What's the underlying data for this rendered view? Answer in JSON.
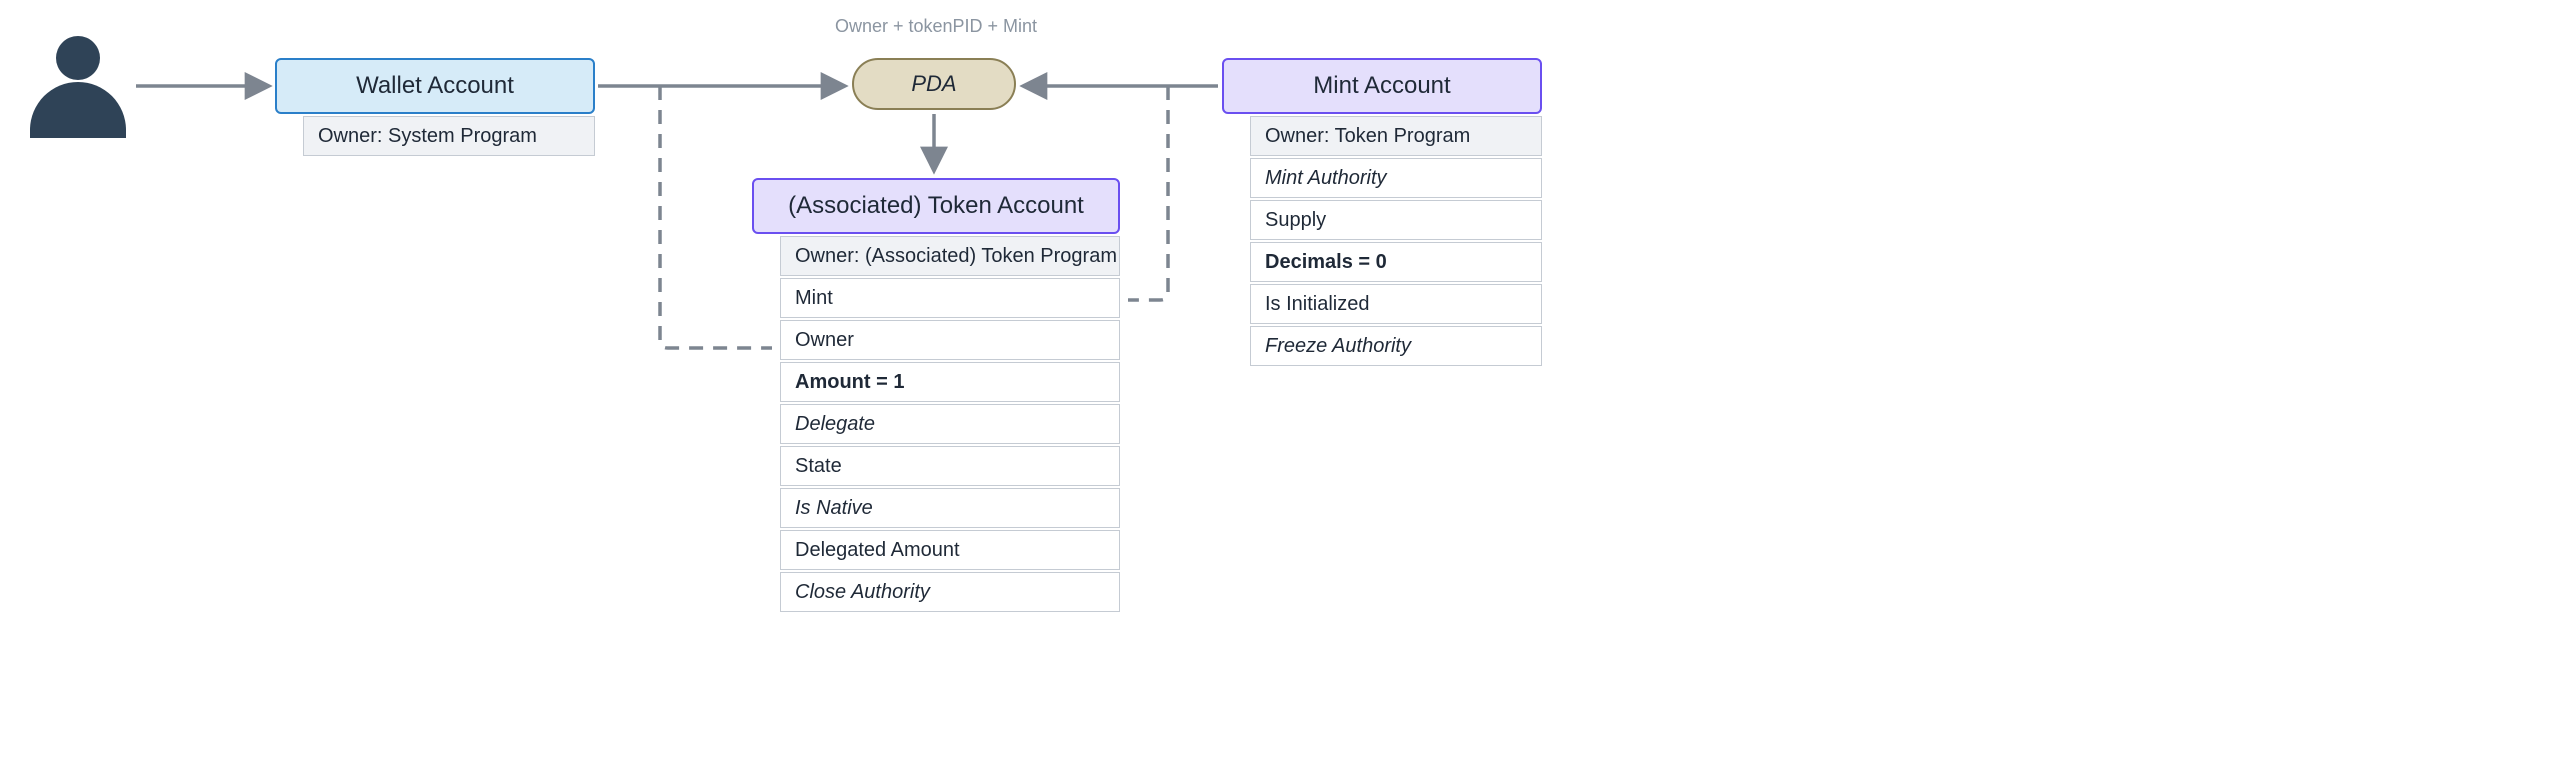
{
  "pda": {
    "annotation": "Owner + tokenPID + Mint",
    "label": "PDA"
  },
  "wallet": {
    "title": "Wallet Account",
    "owner": "Owner: System Program"
  },
  "token": {
    "title": "(Associated) Token Account",
    "owner": "Owner: (Associated) Token Program",
    "fields": {
      "mint": "Mint",
      "owner": "Owner",
      "amount": "Amount = 1",
      "delegate": "Delegate",
      "state": "State",
      "is_native": "Is Native",
      "delegated_amount": "Delegated Amount",
      "close_authority": "Close Authority"
    }
  },
  "mint": {
    "title": "Mint Account",
    "owner": "Owner: Token Program",
    "fields": {
      "mint_authority": "Mint Authority",
      "supply": "Supply",
      "decimals": "Decimals = 0",
      "is_initialized": "Is Initialized",
      "freeze_authority": "Freeze Authority"
    }
  }
}
